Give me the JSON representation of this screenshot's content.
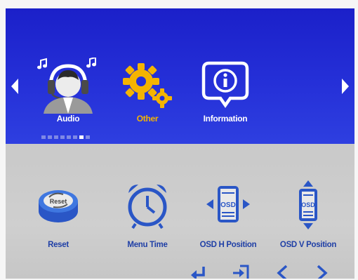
{
  "colors": {
    "panel_top": "#2530d8",
    "panel_bottom": "#cdcdcd",
    "selected_label": "#f4b400",
    "label_top": "#ffffff",
    "label_bottom": "#1f3fa6",
    "icon_blue": "#1f49c4"
  },
  "top_menu": {
    "items": [
      {
        "label": "Audio",
        "icon": "headset-person-icon",
        "selected": false
      },
      {
        "label": "Other",
        "icon": "gears-icon",
        "selected": true
      },
      {
        "label": "Information",
        "icon": "info-bubble-icon",
        "selected": false
      }
    ],
    "page_indicator": {
      "count": 8,
      "active_index": 6
    }
  },
  "sub_menu": {
    "items": [
      {
        "label": "Reset",
        "icon": "reset-button-icon"
      },
      {
        "label": "Menu Time",
        "icon": "alarm-clock-icon"
      },
      {
        "label": "OSD H Position",
        "icon": "osd-h-position-icon"
      },
      {
        "label": "OSD V Position",
        "icon": "osd-v-position-icon"
      }
    ],
    "reset_icon_text": "Reset",
    "osd_icon_text": "OSD"
  },
  "nav_bar": [
    "enter-icon",
    "exit-icon",
    "left-icon",
    "right-icon"
  ]
}
